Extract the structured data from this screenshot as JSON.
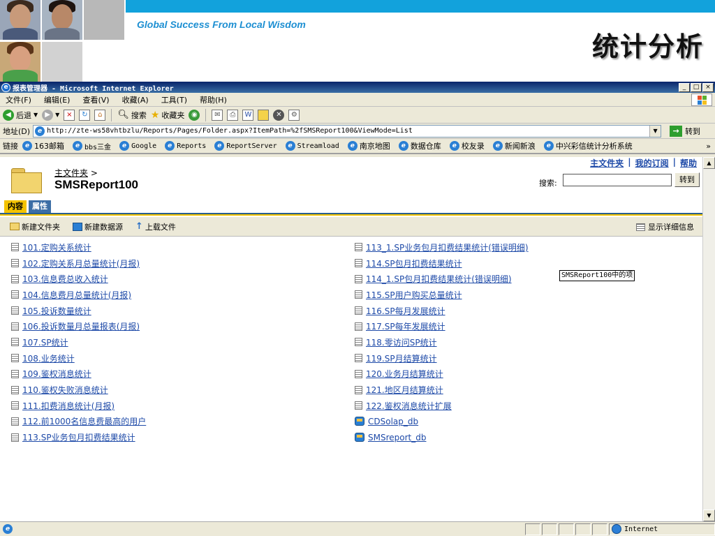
{
  "slide": {
    "tagline": "Global Success From Local Wisdom",
    "title": "统计分析"
  },
  "window": {
    "title": "报表管理器 - Microsoft Internet Explorer",
    "buttons": {
      "minimize": "_",
      "maximize": "□",
      "close": "×"
    }
  },
  "menu": [
    "文件(F)",
    "编辑(E)",
    "查看(V)",
    "收藏(A)",
    "工具(T)",
    "帮助(H)"
  ],
  "toolbar": {
    "back": "后退",
    "search": "搜索",
    "favorites": "收藏夹"
  },
  "address": {
    "label": "地址(D)",
    "url": "http://zte-ws58vhtbzlu/Reports/Pages/Folder.aspx?ItemPath=%2fSMSReport100&ViewMode=List",
    "go": "转到"
  },
  "links": {
    "label": "链接",
    "items": [
      "163邮箱",
      "bbs三金",
      "Google",
      "Reports",
      "ReportServer",
      "Streamload",
      "南京地图",
      "数据仓库",
      "校友录",
      "新闻新浪",
      "中兴彩信统计分析系统"
    ],
    "overflow": "»"
  },
  "page": {
    "toplinks": [
      "主文件夹",
      "我的订阅",
      "帮助"
    ],
    "toplinks_sep": "|",
    "breadcrumb_home": "主文件夹",
    "breadcrumb_sep": ">",
    "folder_title": "SMSReport100",
    "search_label": "搜索:",
    "search_value": "",
    "search_go": "转到",
    "tabs": {
      "content": "内容",
      "properties": "属性"
    },
    "actions": {
      "new_folder": "新建文件夹",
      "new_datasource": "新建数据源",
      "upload": "上载文件",
      "show_details": "显示详细信息"
    }
  },
  "items_col1": [
    "101.定购关系统计",
    "102.定购关系月总量统计(月报)",
    "103.信息费总收入统计",
    "104.信息费月总量统计(月报)",
    "105.投诉数量统计",
    "106.投诉数量月总量报表(月报)",
    "107.SP统计",
    "108.业务统计",
    "109.鉴权消息统计",
    "110.鉴权失败消息统计",
    "111.扣费消息统计(月报)",
    "112.前1000名信息费最高的用户",
    "113.SP业务包月扣费结果统计"
  ],
  "items_col2": [
    "113_1.SP业务包月扣费结果统计(错误明细)",
    "114.SP包月扣费结果统计",
    "114_1.SP包月扣费结果统计(错误明细)",
    "115.SP用户购买总量统计",
    "116.SP每月发展统计",
    "117.SP每年发展统计",
    "118.零访问SP统计",
    "119.SP月结算统计",
    "120.业务月结算统计",
    "121.地区月结算统计",
    "122.鉴权消息统计扩展"
  ],
  "datasources": [
    "CDSolap_db",
    "SMSreport_db"
  ],
  "tooltip": "SMSReport100中的项",
  "status": {
    "zone": "Internet"
  },
  "colors": {
    "accent_blue": "#12a2dc",
    "tab_active": "#f3c300",
    "tab_inactive": "#3c6ea6",
    "link": "#1e4aa8"
  }
}
